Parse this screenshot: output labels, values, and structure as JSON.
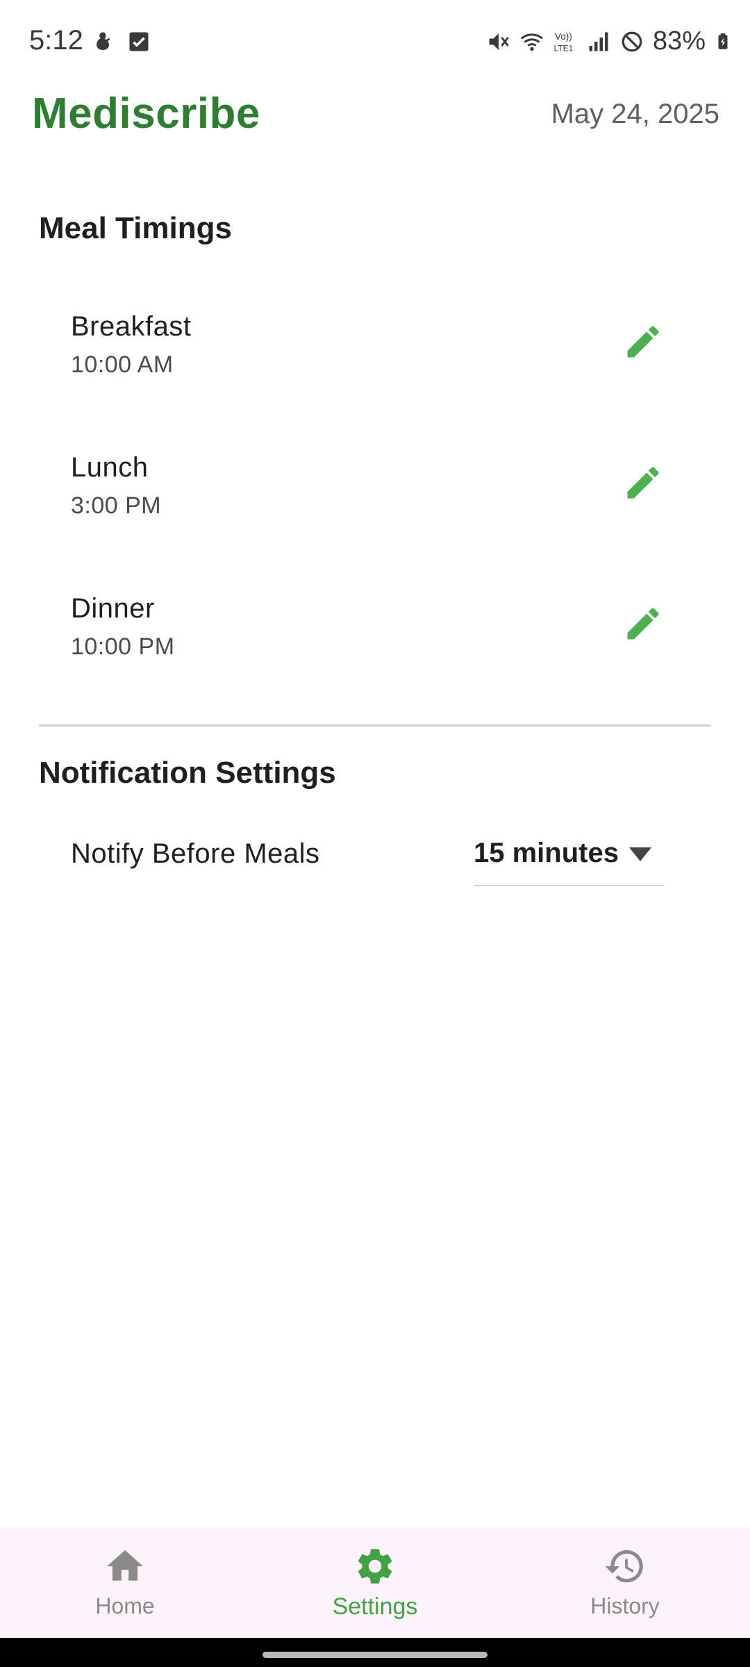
{
  "status_bar": {
    "time": "5:12",
    "battery": "83%"
  },
  "header": {
    "title": "Mediscribe",
    "date": "May 24, 2025"
  },
  "meal_timings": {
    "title": "Meal Timings",
    "meals": [
      {
        "name": "Breakfast",
        "time": "10:00 AM"
      },
      {
        "name": "Lunch",
        "time": "3:00 PM"
      },
      {
        "name": "Dinner",
        "time": "10:00 PM"
      }
    ]
  },
  "notification_settings": {
    "title": "Notification Settings",
    "notify_label": "Notify Before Meals",
    "notify_value": "15 minutes"
  },
  "bottom_nav": {
    "items": [
      {
        "label": "Home",
        "icon": "home-icon",
        "active": false
      },
      {
        "label": "Settings",
        "icon": "gear-icon",
        "active": true
      },
      {
        "label": "History",
        "icon": "history-icon",
        "active": false
      }
    ]
  },
  "colors": {
    "brand": "#2e7d32",
    "accent": "#4caf50",
    "nav_background": "#fcf3fa",
    "inactive": "#8a8a8a"
  }
}
